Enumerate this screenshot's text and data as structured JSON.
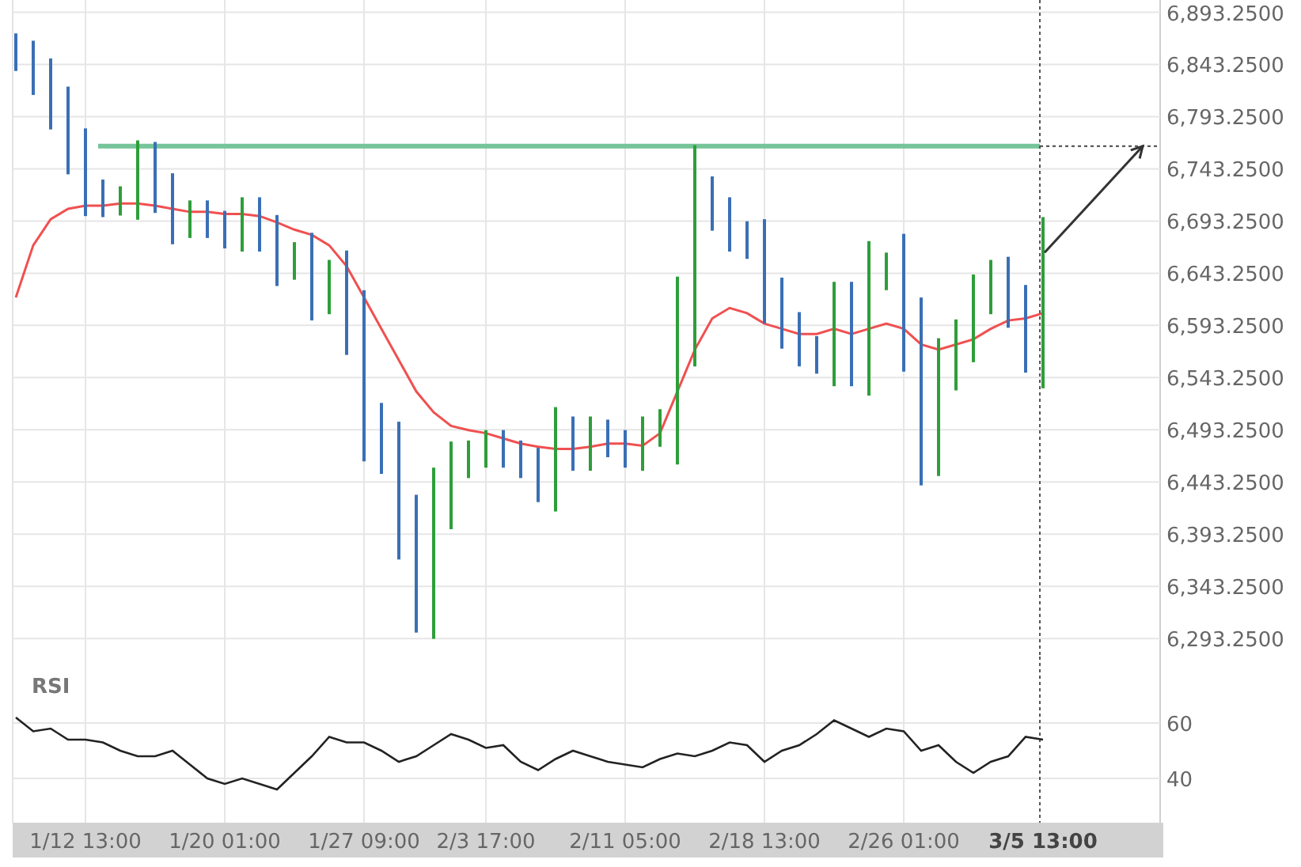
{
  "price_chart": {
    "chart_data": {
      "type": "line",
      "grid": true,
      "ylim": [
        6276,
        6905
      ],
      "yticks": [
        {
          "value": 6893.25,
          "label": "6,893.2500"
        },
        {
          "value": 6843.25,
          "label": "6,843.2500"
        },
        {
          "value": 6793.25,
          "label": "6,793.2500"
        },
        {
          "value": 6743.25,
          "label": "6,743.2500"
        },
        {
          "value": 6693.25,
          "label": "6,693.2500"
        },
        {
          "value": 6643.25,
          "label": "6,643.2500"
        },
        {
          "value": 6593.25,
          "label": "6,593.2500"
        },
        {
          "value": 6543.25,
          "label": "6,543.2500"
        },
        {
          "value": 6493.25,
          "label": "6,493.2500"
        },
        {
          "value": 6443.25,
          "label": "6,443.2500"
        },
        {
          "value": 6393.25,
          "label": "6,393.2500"
        },
        {
          "value": 6343.25,
          "label": "6,343.2500"
        },
        {
          "value": 6293.25,
          "label": "6,293.2500"
        }
      ],
      "series": [
        {
          "color": "#f05050",
          "values": [
            6620,
            6670,
            6695,
            6705,
            6708,
            6708,
            6710,
            6710,
            6708,
            6705,
            6702,
            6702,
            6700,
            6700,
            6698,
            6692,
            6685,
            6680,
            6670,
            6650,
            6620,
            6590,
            6560,
            6530,
            6510,
            6497,
            6493,
            6490,
            6485,
            6480,
            6477,
            6475,
            6475,
            6477,
            6480,
            6480,
            6478,
            6490,
            6530,
            6570,
            6600,
            6610,
            6605,
            6595,
            6590,
            6585,
            6585,
            6590,
            6585,
            6590,
            6595,
            6590,
            6575,
            6570,
            6575,
            6580,
            6590,
            6598,
            6600,
            6605
          ]
        }
      ],
      "ref_lines": [
        {
          "axis": "y",
          "value": 6765,
          "color": "#76c49a"
        }
      ]
    }
  },
  "rsi_chart": {
    "chart_data": {
      "type": "line",
      "grid": true,
      "title": "RSI",
      "ylim": [
        24,
        84
      ],
      "yticks": [
        40,
        60
      ],
      "categories": [
        null,
        null,
        null,
        null,
        "1/12 13:00",
        null,
        null,
        null,
        null,
        null,
        null,
        null,
        "1/20 01:00",
        null,
        null,
        null,
        null,
        null,
        null,
        null,
        "1/27 09:00",
        null,
        null,
        null,
        null,
        null,
        null,
        "2/3 17:00",
        null,
        null,
        null,
        null,
        null,
        null,
        null,
        "2/11 05:00",
        null,
        null,
        null,
        null,
        null,
        null,
        null,
        "2/18 13:00",
        null,
        null,
        null,
        null,
        null,
        null,
        null,
        "2/26 01:00",
        null,
        null,
        null,
        null,
        null,
        null,
        null,
        "3/5 13:00"
      ],
      "series": [
        {
          "color": "#222222",
          "values": [
            62,
            57,
            58,
            54,
            54,
            53,
            50,
            48,
            48,
            50,
            45,
            40,
            38,
            40,
            38,
            36,
            42,
            48,
            55,
            53,
            53,
            50,
            46,
            48,
            52,
            56,
            54,
            51,
            52,
            46,
            43,
            47,
            50,
            48,
            46,
            45,
            44,
            47,
            49,
            48,
            50,
            53,
            52,
            46,
            50,
            52,
            56,
            61,
            58,
            55,
            58,
            57,
            50,
            52,
            46,
            42,
            46,
            48,
            55,
            54
          ]
        }
      ]
    }
  }
}
